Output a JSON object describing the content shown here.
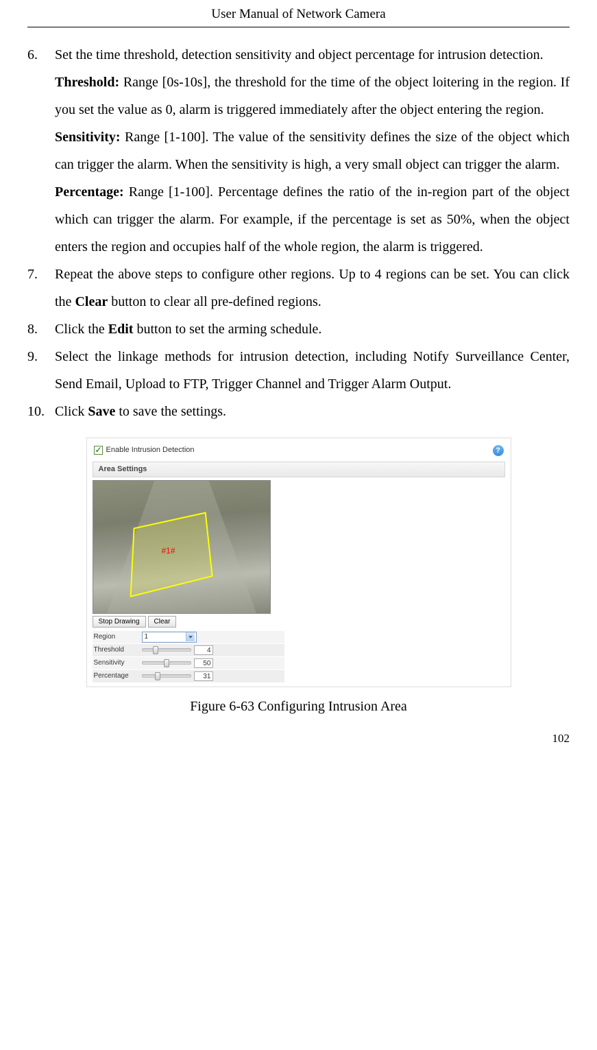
{
  "header": {
    "title": "User Manual of Network Camera"
  },
  "items": [
    {
      "num": "6.",
      "intro": "Set the time threshold, detection sensitivity and object percentage for intrusion detection.",
      "threshold_label": "Threshold:",
      "threshold_text": " Range [0s-10s], the threshold for the time of the object loitering in the region. If you set the value as 0, alarm is triggered immediately after the object entering the region.",
      "sensitivity_label": "Sensitivity:",
      "sensitivity_text": " Range [1-100]. The value of the sensitivity defines the size of the object which can trigger the alarm. When the sensitivity is high, a very small object can trigger the alarm.",
      "percentage_label": "Percentage:",
      "percentage_text": " Range [1-100]. Percentage defines the ratio of the in-region part of the object which can trigger the alarm. For example, if the percentage is set as 50%, when the object enters the region and occupies half of the whole region, the alarm is triggered."
    },
    {
      "num": "7.",
      "text_a": "Repeat the above steps to configure other regions. Up to 4 regions can be set. You can click the ",
      "bold": "Clear",
      "text_b": " button to clear all pre-defined regions."
    },
    {
      "num": "8.",
      "text_a": "Click the ",
      "bold": "Edit",
      "text_b": " button to set the arming schedule."
    },
    {
      "num": "9.",
      "text": "Select the linkage methods for intrusion detection, including Notify Surveillance Center, Send Email, Upload to FTP, Trigger Channel and Trigger Alarm Output."
    },
    {
      "num": "10.",
      "text_a": "Click ",
      "bold": "Save",
      "text_b": " to save the settings."
    }
  ],
  "figure": {
    "enable_label": "Enable Intrusion Detection",
    "area_settings_label": "Area Settings",
    "region_label": "#1#",
    "buttons": {
      "stop_drawing": "Stop Drawing",
      "clear": "Clear"
    },
    "settings": {
      "region": {
        "label": "Region",
        "value": "1"
      },
      "threshold": {
        "label": "Threshold",
        "value": "4",
        "pos_pct": 25
      },
      "sensitivity": {
        "label": "Sensitivity",
        "value": "50",
        "pos_pct": 50
      },
      "percentage": {
        "label": "Percentage",
        "value": "31",
        "pos_pct": 31
      }
    },
    "caption": "Figure 6-63 Configuring Intrusion Area"
  },
  "page_number": "102"
}
